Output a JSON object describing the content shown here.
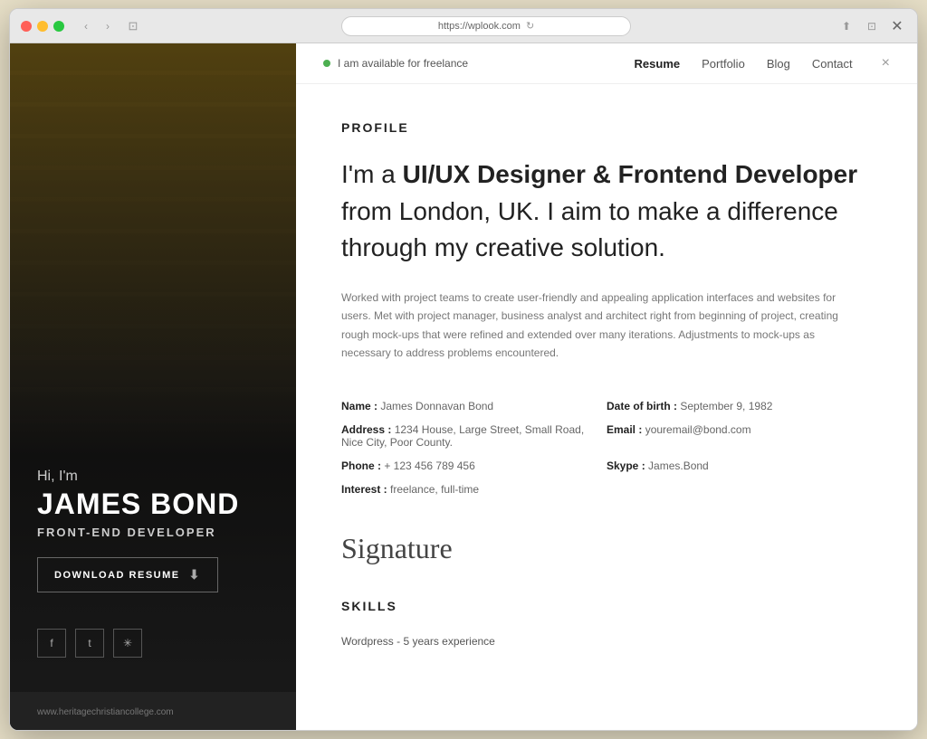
{
  "browser": {
    "url": "https://wplook.com",
    "nav_back": "‹",
    "nav_forward": "›",
    "share_icon": "⬆",
    "window_icon": "⊡",
    "close_icon": "×"
  },
  "sidebar": {
    "hi_text": "Hi, I'm",
    "name": "JAMES BOND",
    "title": "FRONT-END DEVELOPER",
    "download_btn": "DOWNLOAD RESUME",
    "social": [
      {
        "icon": "f",
        "label": "facebook"
      },
      {
        "icon": "t",
        "label": "twitter"
      },
      {
        "icon": "*",
        "label": "dribbble"
      }
    ],
    "website_url": "www.heritagechristiancollege.com"
  },
  "nav": {
    "available_text": "I am available for freelance",
    "items": [
      {
        "label": "Resume",
        "active": true
      },
      {
        "label": "Portfolio",
        "active": false
      },
      {
        "label": "Blog",
        "active": false
      },
      {
        "label": "Contact",
        "active": false
      }
    ],
    "close": "×"
  },
  "profile": {
    "section_title": "PROFILE",
    "headline_part1": "I'm a ",
    "headline_bold": "UI/UX Designer & Frontend Developer",
    "headline_part2": " from London, UK. I aim to make a difference through my creative solution.",
    "description": "Worked with project teams to create user-friendly and appealing application interfaces and websites for users. Met with project manager, business analyst and architect right from beginning of project, creating rough mock-ups that were refined and extended over many iterations. Adjustments to mock-ups as necessary to address problems encountered.",
    "details": {
      "name_label": "Name :",
      "name_value": "James Donnavan Bond",
      "dob_label": "Date of birth :",
      "dob_value": "September 9, 1982",
      "address_label": "Address :",
      "address_value": "1234 House, Large Street, Small Road, Nice City, Poor County.",
      "email_label": "Email :",
      "email_value": "youremail@bond.com",
      "phone_label": "Phone :",
      "phone_value": "+ 123 456 789 456",
      "skype_label": "Skype :",
      "skype_value": "James.Bond",
      "interest_label": "Interest :",
      "interest_value": "freelance, full-time"
    },
    "signature": "Signature"
  },
  "skills": {
    "section_title": "SKILLS",
    "first_skill": "Wordpress - 5 years experience"
  }
}
